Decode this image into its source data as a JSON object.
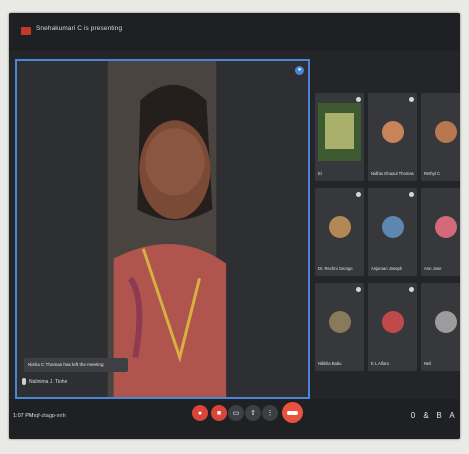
{
  "topbar": {
    "presenting_text": "Snehakumari C is presenting"
  },
  "main": {
    "toast": "Nisha C Thomas has left the meeting",
    "name": "Nalinima J. Tiohe",
    "pin_icon": "pin-icon"
  },
  "tiles": [
    {
      "name": "El",
      "color": "#a8b06c"
    },
    {
      "name": "Nidhia Ghaoul Thomas",
      "color": "#c7845a"
    },
    {
      "name": "Rethyl C",
      "color": "#b7774f"
    },
    {
      "name": "Dr. Rechni George",
      "color": "#b28856"
    },
    {
      "name": "Anjuman Joseph",
      "color": "#5d87b0"
    },
    {
      "name": "Ann Jose",
      "color": "#d46a79"
    },
    {
      "name": "Nikhila Babu",
      "color": "#8a7a5c"
    },
    {
      "name": "K L Alfaro",
      "color": "#c04a4a"
    },
    {
      "name": "Neil",
      "color": "#9c9c9c"
    }
  ],
  "bottombar": {
    "time": "1:07 PM",
    "meeting_code": "hqf-ztagp-xnh",
    "right_icon_labels": [
      "0",
      "&",
      "B",
      "A"
    ]
  }
}
